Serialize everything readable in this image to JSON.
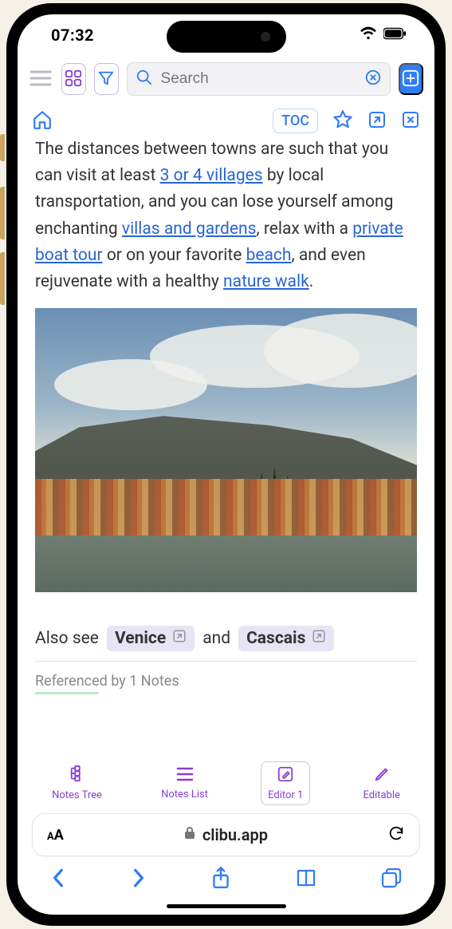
{
  "statusbar": {
    "time": "07:32"
  },
  "toolbar1": {
    "search_placeholder": "Search"
  },
  "toolbar2": {
    "toc_label": "TOC"
  },
  "article": {
    "text_pre": "The distances between towns are such that you can visit at least ",
    "link_villages": "3 or 4 villages",
    "text_after_villages": " by local transportation, and you can lose yourself among enchanting ",
    "link_villas": "villas and gardens",
    "text_after_villas": ", relax with a ",
    "link_boat": "private boat tour",
    "text_after_boat": " or on your favorite ",
    "link_beach": "beach",
    "text_after_beach": ", and even rejuvenate with a healthy ",
    "link_walk": "nature walk",
    "text_end": "."
  },
  "alsosee": {
    "label": "Also see",
    "conjunction": "and",
    "chips": [
      "Venice",
      "Cascais"
    ]
  },
  "refby": {
    "label": "Referenced by 1 Notes"
  },
  "apptabs": {
    "tree": "Notes Tree",
    "list": "Notes List",
    "editor": "Editor 1",
    "editable": "Editable"
  },
  "addressbar": {
    "domain": "clibu.app"
  }
}
